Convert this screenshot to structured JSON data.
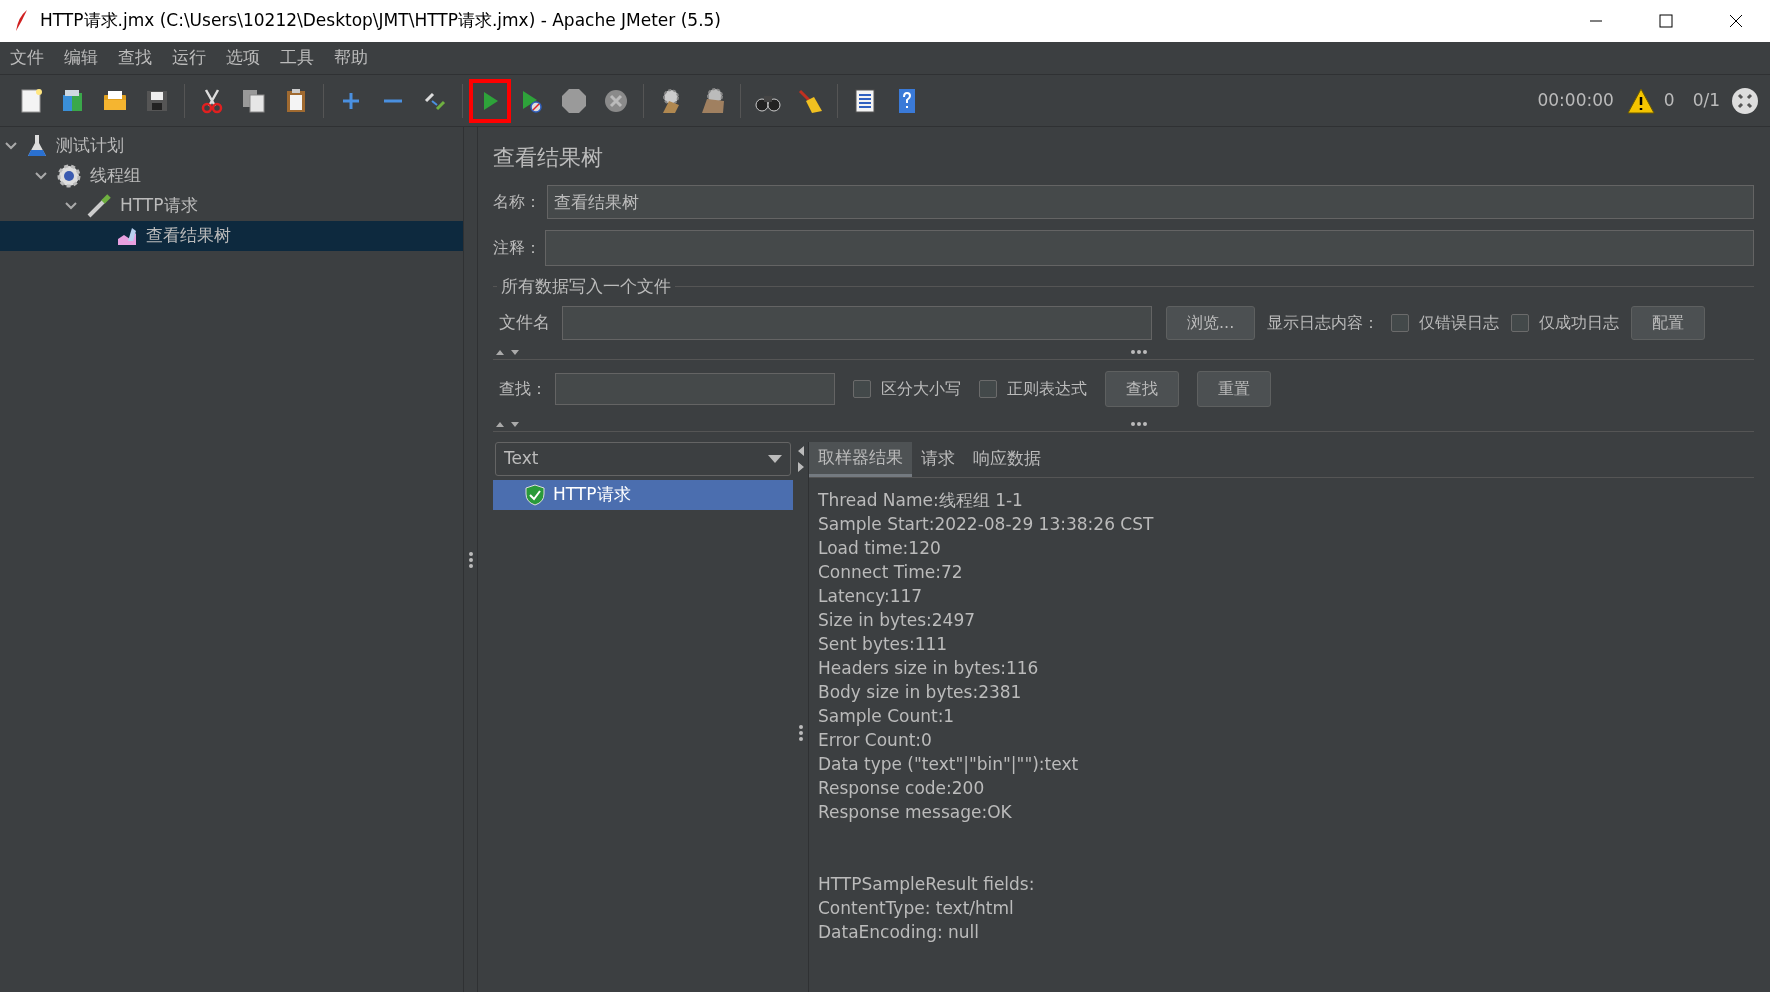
{
  "window": {
    "title": "HTTP请求.jmx (C:\\Users\\10212\\Desktop\\JMT\\HTTP请求.jmx) - Apache JMeter (5.5)"
  },
  "menu": [
    "文件",
    "编辑",
    "查找",
    "运行",
    "选项",
    "工具",
    "帮助"
  ],
  "toolbar": [
    {
      "tools": [
        {
          "kind": "new",
          "highlighted": false
        },
        {
          "kind": "templates",
          "highlighted": false
        },
        {
          "kind": "open",
          "highlighted": false
        },
        {
          "kind": "save",
          "highlighted": false
        }
      ]
    },
    {
      "tools": [
        {
          "kind": "cut",
          "highlighted": false
        },
        {
          "kind": "copy",
          "highlighted": false
        },
        {
          "kind": "paste",
          "highlighted": false
        }
      ]
    },
    {
      "tools": [
        {
          "kind": "expand",
          "highlighted": false
        },
        {
          "kind": "collapse",
          "highlighted": false
        },
        {
          "kind": "toggle",
          "highlighted": false
        }
      ]
    },
    {
      "tools": [
        {
          "kind": "start",
          "highlighted": true
        },
        {
          "kind": "start-no-pause",
          "highlighted": false
        },
        {
          "kind": "stop",
          "highlighted": false
        },
        {
          "kind": "shutdown",
          "highlighted": false
        }
      ]
    },
    {
      "tools": [
        {
          "kind": "clear",
          "highlighted": false
        },
        {
          "kind": "clear-all",
          "highlighted": false
        }
      ]
    },
    {
      "tools": [
        {
          "kind": "search",
          "highlighted": false
        },
        {
          "kind": "reset",
          "highlighted": false
        }
      ]
    },
    {
      "tools": [
        {
          "kind": "functions",
          "highlighted": false
        },
        {
          "kind": "help",
          "highlighted": false
        }
      ]
    }
  ],
  "status": {
    "time": "00:00:00",
    "warnings": "0",
    "threads": "0/1"
  },
  "tree": [
    {
      "kind": "test-plan",
      "label": "测试计划",
      "expanded": true,
      "selected": false,
      "children": [
        {
          "kind": "thread-group",
          "label": "线程组",
          "expanded": true,
          "selected": false,
          "children": [
            {
              "kind": "sampler",
              "label": "HTTP请求",
              "expanded": true,
              "selected": false,
              "children": [
                {
                  "kind": "listener",
                  "label": "查看结果树",
                  "selected": true
                }
              ]
            }
          ]
        }
      ]
    }
  ],
  "panel": {
    "title": "查看结果树",
    "name_label": "名称：",
    "name_value": "查看结果树",
    "comment_label": "注释：",
    "file_group": {
      "title": "所有数据写入一个文件",
      "file_label": "文件名",
      "browse": "浏览...",
      "log_label": "显示日志内容：",
      "checkboxes": [
        {
          "label": "仅错误日志",
          "checked": false
        },
        {
          "label": "仅成功日志",
          "checked": false
        }
      ],
      "configure": "配置"
    },
    "search": {
      "label": "查找：",
      "checkboxes": [
        {
          "label": "区分大小写",
          "checked": false
        },
        {
          "label": "正则表达式",
          "checked": false
        }
      ],
      "find": "查找",
      "reset": "重置"
    },
    "renderer": "Text",
    "results": [
      {
        "label": "HTTP请求",
        "selected": true
      }
    ],
    "tabs": [
      {
        "label": "取样器结果",
        "selected": true
      },
      {
        "label": "请求",
        "selected": false
      },
      {
        "label": "响应数据",
        "selected": false
      }
    ],
    "result_sections": [
      {
        "lines": [
          "Thread Name:线程组 1-1",
          "Sample Start:2022-08-29 13:38:26 CST",
          "Load time:120",
          "Connect Time:72",
          "Latency:117",
          "Size in bytes:2497",
          "Sent bytes:111",
          "Headers size in bytes:116",
          "Body size in bytes:2381",
          "Sample Count:1",
          "Error Count:0",
          "Data type (\"text\"|\"bin\"|\"\"):text",
          "Response code:200",
          "Response message:OK"
        ]
      },
      {
        "lines": [
          "HTTPSampleResult fields:",
          "ContentType: text/html",
          "DataEncoding: null"
        ]
      }
    ]
  }
}
